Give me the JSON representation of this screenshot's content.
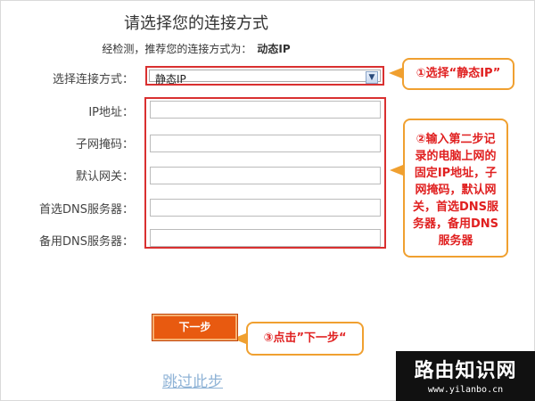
{
  "page": {
    "title": "请选择您的连接方式",
    "detect_text": "经检测，推荐您的连接方式为：",
    "detect_value": "动态IP"
  },
  "form": {
    "connection_label": "选择连接方式：",
    "connection_value": "静态IP",
    "ip_label": "IP地址：",
    "mask_label": "子网掩码：",
    "gateway_label": "默认网关：",
    "dns1_label": "首选DNS服务器：",
    "dns2_label": "备用DNS服务器：",
    "ip_value": "",
    "mask_value": "",
    "gateway_value": "",
    "dns1_value": "",
    "dns2_value": ""
  },
  "buttons": {
    "next_label": "下一步",
    "skip_label": "跳过此步"
  },
  "annotations": {
    "step1": "①选择“静态IP”",
    "step2_lines": [
      "②输入第二步记",
      "录的电脑上网的",
      "固定IP地址，子",
      "网掩码，默认网",
      "关，首选DNS服",
      "务器，备用DNS",
      "服务器"
    ],
    "step3": "③点击”下一步“"
  },
  "watermark": {
    "name": "路由知识网",
    "url": "www.yilanbo.cn"
  },
  "colors": {
    "highlight_border": "#d93030",
    "callout_border": "#f0a030",
    "callout_text": "#e02020",
    "button": "#e85a10",
    "link": "#8fb3d6"
  },
  "icons": {
    "select_arrow": "chevron-down-icon"
  }
}
